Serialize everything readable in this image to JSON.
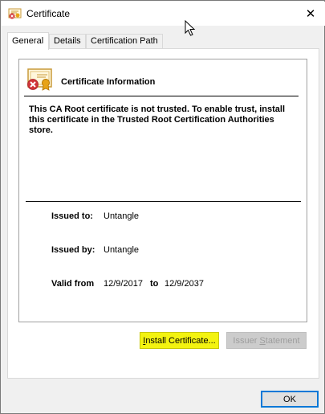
{
  "window": {
    "title": "Certificate",
    "close_glyph": "✕",
    "icon": "certificate-icon"
  },
  "tabs": [
    {
      "label": "General",
      "active": true
    },
    {
      "label": "Details",
      "active": false
    },
    {
      "label": "Certification Path",
      "active": false
    }
  ],
  "info": {
    "header": "Certificate Information",
    "message": "This CA Root certificate is not trusted. To enable trust, install this certificate in the Trusted Root Certification Authorities store.",
    "issued_to_label": "Issued to:",
    "issued_to_value": "Untangle",
    "issued_by_label": "Issued by:",
    "issued_by_value": "Untangle",
    "valid_from_label": "Valid from",
    "valid_from_value": "12/9/2017",
    "valid_to_label": "to",
    "valid_to_value": "12/9/2037"
  },
  "buttons": {
    "install_prefix": "I",
    "install_rest": "nstall Certificate...",
    "issuer_prefix": "Issuer ",
    "issuer_accel": "S",
    "issuer_rest": "tatement",
    "ok": "OK"
  },
  "colors": {
    "highlight": "#f3f310",
    "focus_border": "#0078d7",
    "error_red": "#d13438"
  }
}
